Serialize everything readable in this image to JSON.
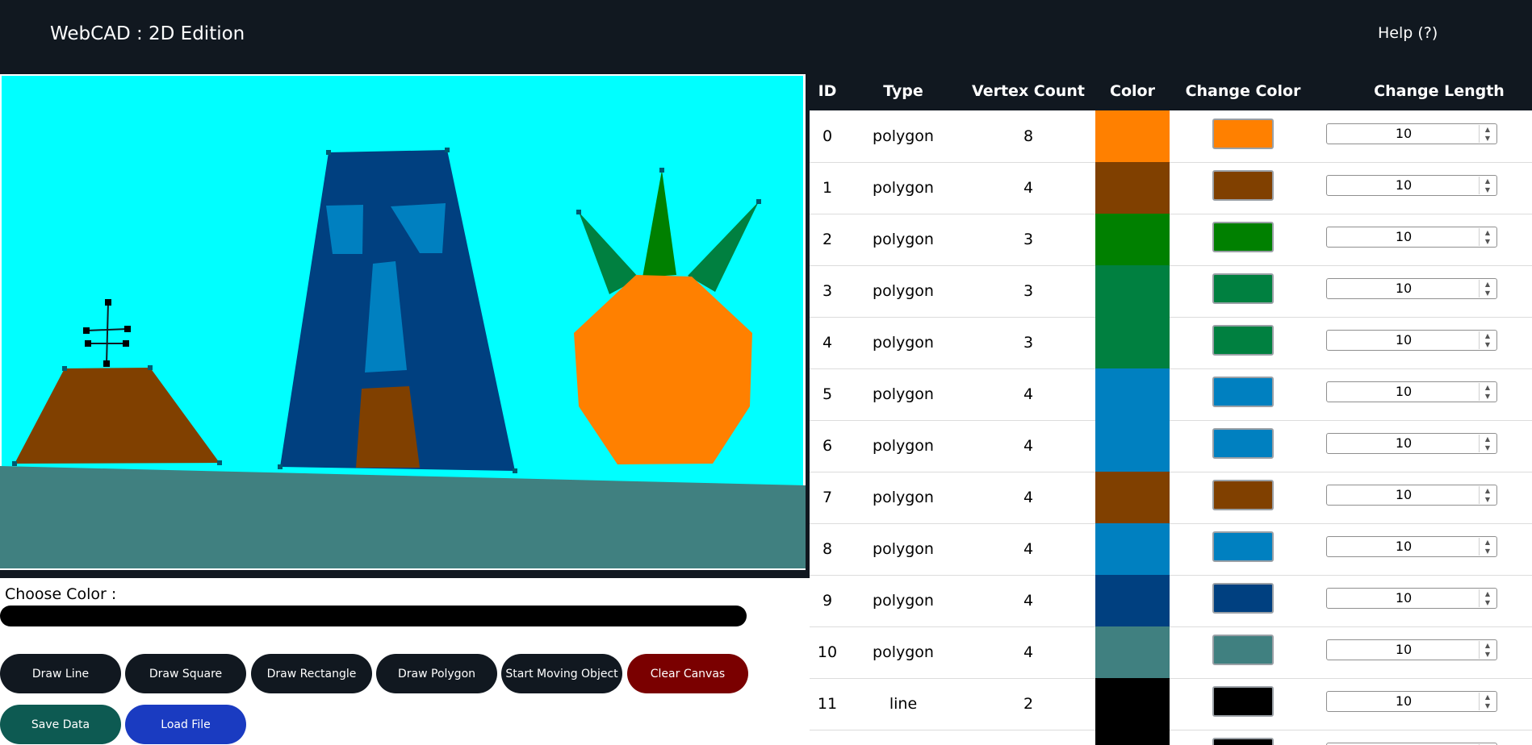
{
  "navbar": {
    "brand": "WebCAD : 2D Edition",
    "help": "Help (?)"
  },
  "controls": {
    "choose_color_label": "Choose Color :",
    "color_value": "#000000",
    "buttons": [
      {
        "label": "Draw Line",
        "color": "#111820"
      },
      {
        "label": "Draw Square",
        "color": "#111820"
      },
      {
        "label": "Draw Rectangle",
        "color": "#111820"
      },
      {
        "label": "Draw Polygon",
        "color": "#111820"
      },
      {
        "label": "Start Moving Object",
        "color": "#111820"
      },
      {
        "label": "Clear Canvas",
        "color": "#7a0000"
      },
      {
        "label": "Save Data",
        "color": "#0d5a52"
      },
      {
        "label": "Load File",
        "color": "#1a3bc1"
      }
    ]
  },
  "table": {
    "headers": [
      "ID",
      "Type",
      "Vertex Count",
      "Color",
      "Change Color",
      "Change Length"
    ],
    "rows": [
      {
        "id": "0",
        "type": "polygon",
        "vertex_count": "8",
        "color": "#ff8000",
        "length": "10"
      },
      {
        "id": "1",
        "type": "polygon",
        "vertex_count": "4",
        "color": "#804000",
        "length": "10"
      },
      {
        "id": "2",
        "type": "polygon",
        "vertex_count": "3",
        "color": "#008000",
        "length": "10"
      },
      {
        "id": "3",
        "type": "polygon",
        "vertex_count": "3",
        "color": "#008040",
        "length": "10"
      },
      {
        "id": "4",
        "type": "polygon",
        "vertex_count": "3",
        "color": "#008040",
        "length": "10"
      },
      {
        "id": "5",
        "type": "polygon",
        "vertex_count": "4",
        "color": "#0080c0",
        "length": "10"
      },
      {
        "id": "6",
        "type": "polygon",
        "vertex_count": "4",
        "color": "#0080c0",
        "length": "10"
      },
      {
        "id": "7",
        "type": "polygon",
        "vertex_count": "4",
        "color": "#804000",
        "length": "10"
      },
      {
        "id": "8",
        "type": "polygon",
        "vertex_count": "4",
        "color": "#0080c0",
        "length": "10"
      },
      {
        "id": "9",
        "type": "polygon",
        "vertex_count": "4",
        "color": "#004080",
        "length": "10"
      },
      {
        "id": "10",
        "type": "polygon",
        "vertex_count": "4",
        "color": "#408080",
        "length": "10"
      },
      {
        "id": "11",
        "type": "line",
        "vertex_count": "2",
        "color": "#000000",
        "length": "10"
      },
      {
        "id": "",
        "type": "",
        "vertex_count": "",
        "color": "#000000",
        "length": ""
      }
    ]
  },
  "canvas": {
    "background": "#00ffff",
    "ground_color": "#408080"
  }
}
